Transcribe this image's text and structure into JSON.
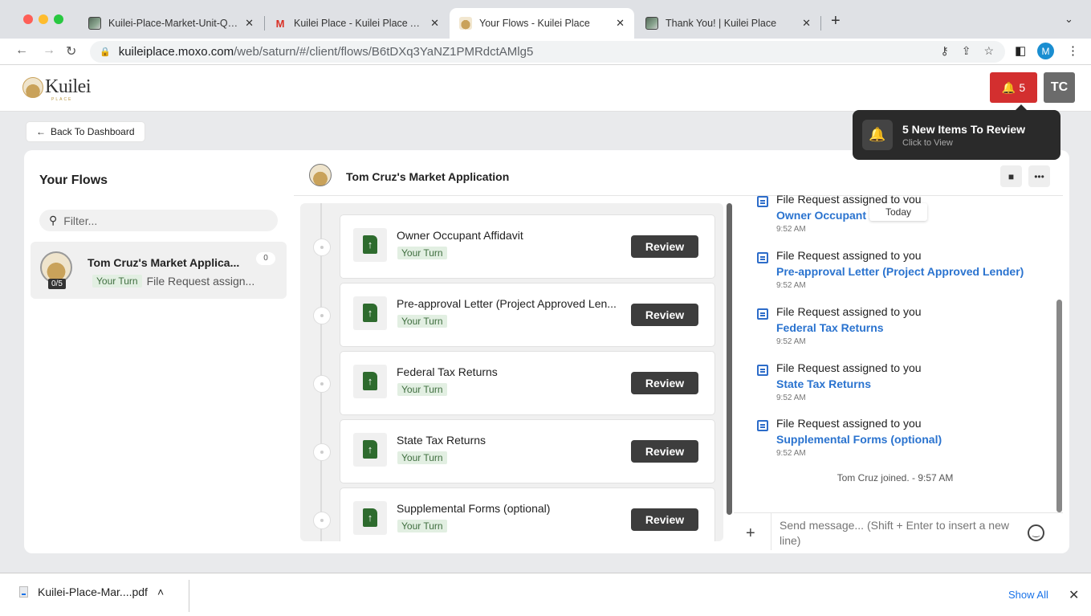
{
  "browser": {
    "tabs": [
      {
        "title": "Kuilei-Place-Market-Unit-QRA",
        "close": "✕"
      },
      {
        "title": "Kuilei Place - Kuilei Place Admi",
        "close": "✕"
      },
      {
        "title": "Your Flows - Kuilei Place",
        "close": "✕"
      },
      {
        "title": "Thank You! | Kuilei Place",
        "close": "✕"
      }
    ],
    "new_tab": "+",
    "tab_menu": "⌄",
    "url_host": "kuileiplace.moxo.com",
    "url_path": "/web/saturn/#/client/flows/B6tDXq3YaNZ1PMRdctAMlg5",
    "profile_initial": "M"
  },
  "header": {
    "logo_text": "Kuilei",
    "logo_sub": "PLACE",
    "notification_count": "5",
    "user_initials": "TC"
  },
  "toast": {
    "title": "5 New Items To Review",
    "subtitle": "Click to View"
  },
  "back_label": "Back To Dashboard",
  "flows_panel": {
    "title": "Your Flows",
    "filter_placeholder": "Filter...",
    "items": [
      {
        "name": "Tom Cruz's Market Applica...",
        "count": "0",
        "progress": "0/5",
        "badge": "Your Turn",
        "preview": "File Request assign..."
      }
    ]
  },
  "flow": {
    "title": "Tom Cruz's Market Application",
    "steps": [
      {
        "name": "Owner Occupant Affidavit",
        "badge": "Your Turn",
        "action": "Review"
      },
      {
        "name": "Pre-approval Letter (Project Approved Len...",
        "badge": "Your Turn",
        "action": "Review"
      },
      {
        "name": "Federal Tax Returns",
        "badge": "Your Turn",
        "action": "Review"
      },
      {
        "name": "State Tax Returns",
        "badge": "Your Turn",
        "action": "Review"
      },
      {
        "name": "Supplemental Forms (optional)",
        "badge": "Your Turn",
        "action": "Review"
      }
    ]
  },
  "feed": {
    "date_chip": "Today",
    "items": [
      {
        "head": "File Request assigned to you",
        "link": "Owner Occupant Affidavit",
        "time": "9:52 AM"
      },
      {
        "head": "File Request assigned to you",
        "link": "Pre-approval Letter (Project Approved Lender)",
        "time": "9:52 AM"
      },
      {
        "head": "File Request assigned to you",
        "link": "Federal Tax Returns",
        "time": "9:52 AM"
      },
      {
        "head": "File Request assigned to you",
        "link": "State Tax Returns",
        "time": "9:52 AM"
      },
      {
        "head": "File Request assigned to you",
        "link": "Supplemental Forms (optional)",
        "time": "9:52 AM"
      }
    ],
    "joined": "Tom Cruz joined. - 9:57 AM"
  },
  "composer": {
    "placeholder": "Send message... (Shift + Enter to insert a new line)"
  },
  "downloads": {
    "file": "Kuilei-Place-Mar....pdf",
    "show_all": "Show All"
  },
  "colors": {
    "accent_blue": "#2a73cf",
    "notification_red": "#d32f2f",
    "file_green": "#2e6b2e"
  }
}
